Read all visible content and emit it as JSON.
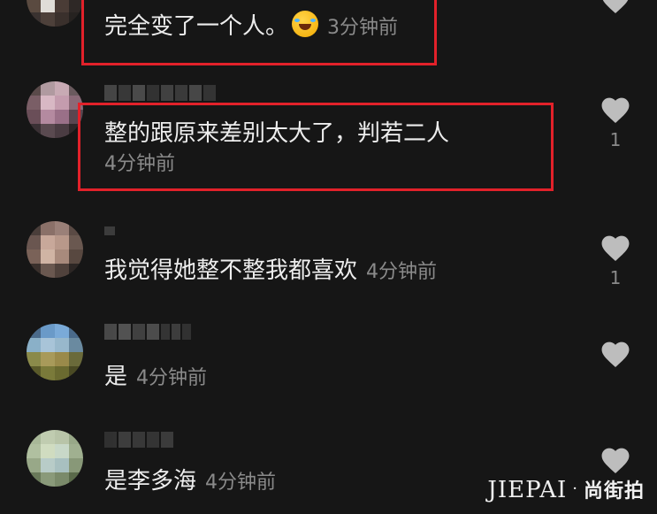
{
  "comments": [
    {
      "text": "完全变了一个人。",
      "emoji": "rolling-on-floor-laughing-emoji",
      "time": "3分钟前",
      "likes": ""
    },
    {
      "text": "整的跟原来差别太大了，判若二人",
      "time": "4分钟前",
      "likes": "1"
    },
    {
      "text": "我觉得她整不整我都喜欢",
      "time": "4分钟前",
      "likes": "1"
    },
    {
      "text": "是",
      "time": "4分钟前",
      "likes": ""
    },
    {
      "text": "是李多海",
      "time": "4分钟前",
      "likes": ""
    }
  ],
  "watermark": {
    "latin": "JIEPAI",
    "separator": "·",
    "chinese": "尚街拍"
  },
  "colors": {
    "background": "#161616",
    "highlight_border": "#e2212a",
    "secondary_text": "#8a8a8a",
    "heart": "#bdbdbd"
  }
}
